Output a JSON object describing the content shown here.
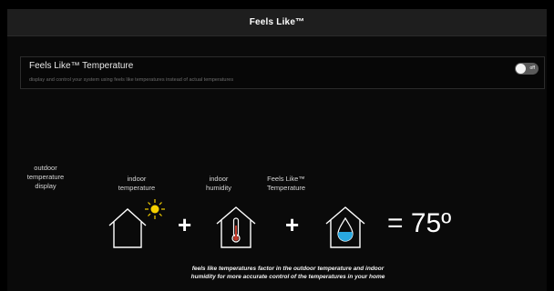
{
  "header": {
    "title": "Feels Like™"
  },
  "setting": {
    "title": "Feels Like™ Temperature",
    "description": "display and control your system using feels like temperatures instead of actual temperatures",
    "toggle_label": "off",
    "toggle_state": "off"
  },
  "equation": {
    "labels": {
      "outdoor": "outdoor\ntemperature\ndisplay",
      "indoor_temperature": "indoor\ntemperature",
      "indoor_humidity": "indoor\nhumidity",
      "feels_like": "Feels Like™\nTemperature"
    },
    "plus": "+",
    "result": "= 75º"
  },
  "footer": {
    "line1": "feels like temperatures factor in the outdoor temperature and indoor",
    "line2": "humidity for more accurate control of the temperatures in your home"
  },
  "colors": {
    "sun": "#f5d000",
    "thermometer": "#c0392b",
    "water": "#29a8e0",
    "outline": "#ffffff"
  }
}
